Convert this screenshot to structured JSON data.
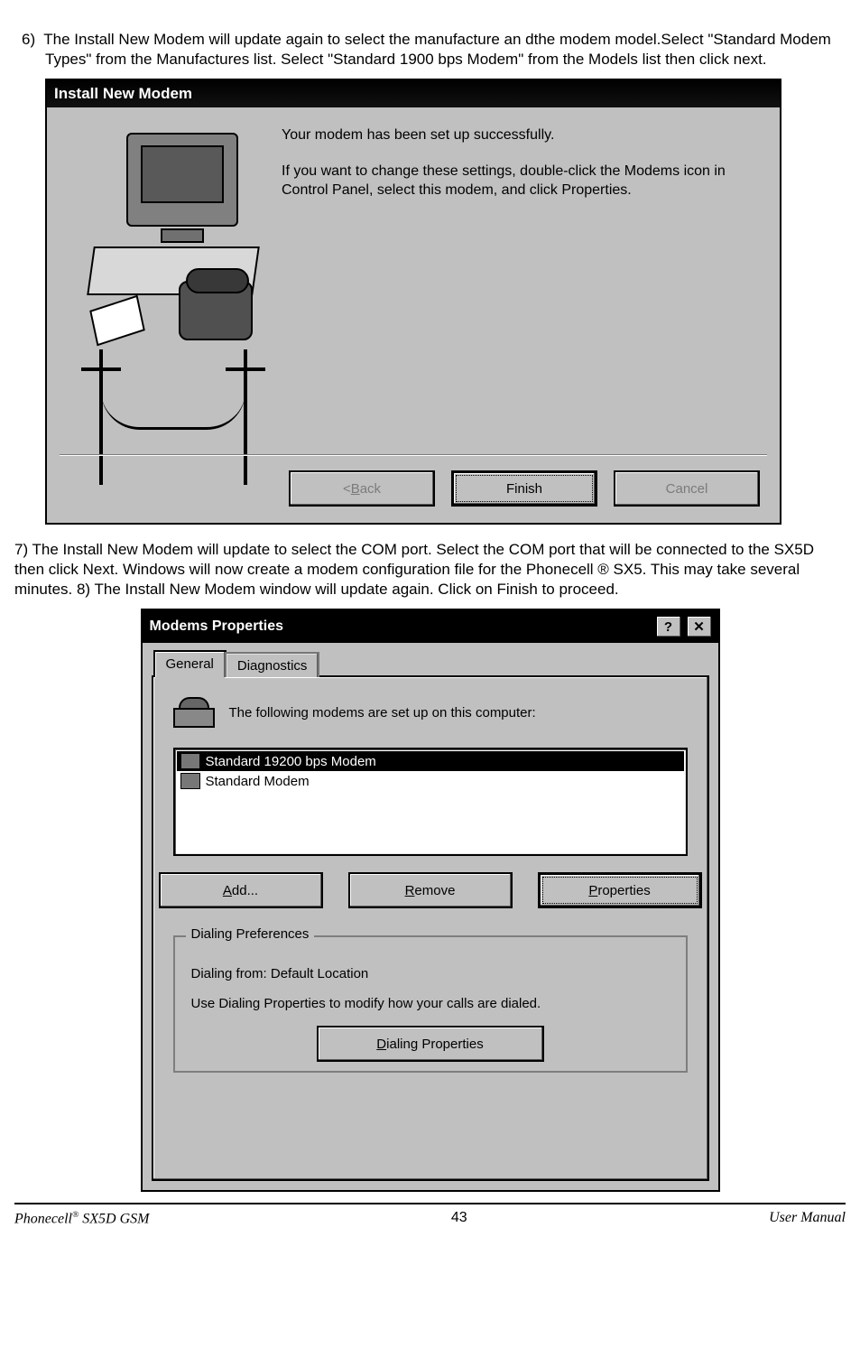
{
  "step6": {
    "num": "6)",
    "text": "The Install New Modem will update again to select the manufacture an dthe modem model.Select \"Standard Modem Types\" from the Manufactures list. Select \"Standard 1900 bps Modem\" from the Models list then click next."
  },
  "window1": {
    "title": "Install New Modem",
    "line1": "Your modem has been set up successfully.",
    "line2": "If you want to change these settings, double-click the Modems icon in Control Panel, select this modem, and click Properties.",
    "back_prefix": "< ",
    "back_u": "B",
    "back_suffix": "ack",
    "finish": "Finish",
    "cancel": "Cancel"
  },
  "step78": "7)  The Install New Modem will update to select the COM port. Select the COM port that will be connected to the SX5D then click Next. Windows will now create a modem configuration file for the Phonecell ® SX5. This may take several minutes. 8)  The Install New Modem window will update again. Click on Finish to proceed.",
  "window2": {
    "title": "Modems Properties",
    "help_btn": "?",
    "close_btn": "✕",
    "tab_general": "General",
    "tab_diag": "Diagnostics",
    "intro": "The following modems are set up on this computer:",
    "list": [
      {
        "label": "Standard 19200 bps Modem",
        "selected": true
      },
      {
        "label": "Standard Modem",
        "selected": false
      }
    ],
    "add_u": "A",
    "add_suffix": "dd...",
    "remove_u": "R",
    "remove_suffix": "emove",
    "props_u": "P",
    "props_suffix": "roperties",
    "group_title": "Dialing Preferences",
    "dial_from_label": "Dialing from:   Default Location",
    "dial_desc": "Use Dialing Properties to modify how your calls are dialed.",
    "dp_u": "D",
    "dp_suffix": "ialing Properties"
  },
  "footer": {
    "left_a": "Phonecell",
    "left_b": "®",
    "left_c": " SX5D GSM",
    "center": "43",
    "right": "User Manual"
  }
}
